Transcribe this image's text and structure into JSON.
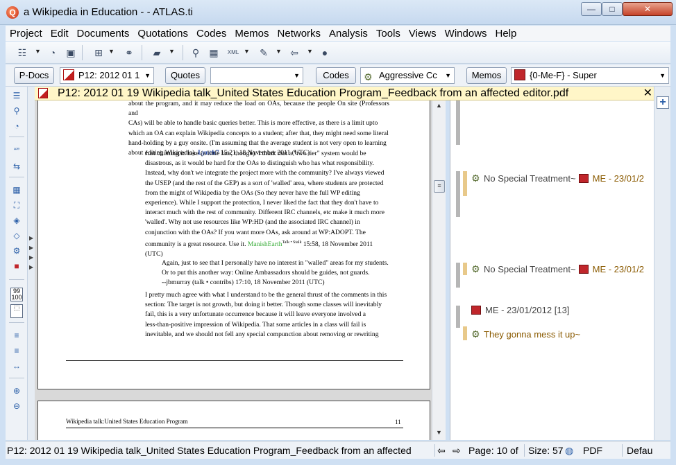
{
  "window": {
    "title": "a Wikipedia in Education - - ATLAS.ti",
    "app_icon_letter": "Q",
    "minimize": "—",
    "maximize": "□",
    "close": "✕"
  },
  "menu": [
    "Project",
    "Edit",
    "Documents",
    "Quotations",
    "Codes",
    "Memos",
    "Networks",
    "Analysis",
    "Tools",
    "Views",
    "Windows",
    "Help"
  ],
  "managers": {
    "pdocs_label": "P-Docs",
    "pdoc_selected": "P12: 2012 01 1",
    "quotes_label": "Quotes",
    "quotes_selected": "",
    "codes_label": "Codes",
    "code_selected": "Aggressive Cc",
    "memos_label": "Memos",
    "memo_selected": "{0-Me-F} - Super"
  },
  "document": {
    "title": "P12: 2012 01 19 Wikipedia talk_United States Education Program_Feedback from an affected editor.pdf",
    "close": "✕",
    "paragraphs": [
      {
        "lines": [
          "about the program, and it may reduce the load on OAs, because the people On site (Professors and",
          "CAs) will be able to handle basic queries better. This is more effective, as there is a limit upto",
          "which an OA can explain Wikipedia concepts to a student; after that, they might need some literal",
          "hand-holding by a guy onsite. (I'm assuming that the average student is not very open to learning"
        ],
        "tail": "about editing Wikipedia).",
        "sig": "Lynch7",
        "sig_after": " 15:21, 18 November 2011 (UTC)"
      },
      {
        "lines": [
          "Just chiming in here (a little late, though). I think that a \"two tier\" system would be",
          "disastrous, as it would be hard for the OAs to distinguish who has what responsibility.",
          "Instead, why don't we integrate the project more with the community? I've always viewed",
          "the USEP (and the rest of the GEP) as a sort of 'walled' area, where students are protected",
          "from the might of Wikipedia by the OAs (So they never have the full WP editing",
          "experience). While I support the protection, I never liked the fact that they don't have to",
          "interact much with the rest of community. Different IRC channels, etc make it much more",
          "'walled'. Why not use resources like WP:HD (and the associated IRC channel) in",
          "conjunction with the OAs? If you want more OAs, ask around at WP:ADOPT. The"
        ],
        "tail": "community is a great resource. Use it.",
        "sig": "ManishEarth",
        "sig_sup": "Talk • Stalk",
        "sig_after": " 15:58, 18 November 2011",
        "last": "(UTC)"
      },
      {
        "lines": [
          "Again, just to see that I personally have no interest in \"walled\" areas for my students.",
          "Or to put this another way: Online Ambassadors should be guides, not guards."
        ],
        "tail": "--jbmurray (talk • contribs) 17:10, 18 November 2011 (UTC)"
      },
      {
        "lines": [
          "I pretty much agree with what I understand to be the general thrust of the comments in this",
          "section: The target is not growth, but doing it better. Though some classes will inevitably",
          "fail, this is a very unfortunate occurrence because it will leave everyone involved a",
          "less-than-positive impression of Wikipedia. That some articles in a class will fail is",
          "inevitable, and we should not fell any special compunction about removing or rewriting"
        ]
      }
    ],
    "footer_left": "Wikipedia talk:United States Education Program",
    "footer_right": "11"
  },
  "margin": [
    {
      "code": "No Special Treatment~",
      "memo": "ME - 23/01/2"
    },
    {
      "code": "No Special Treatment~",
      "memo": "ME - 23/01/2"
    },
    {
      "memo_full": "ME - 23/01/2012 [13]"
    },
    {
      "code": "They gonna mess it up~"
    }
  ],
  "status": {
    "doc": "P12: 2012 01 19 Wikipedia talk_United States Education Program_Feedback from an affected",
    "page": "Page: 10 of",
    "size": "Size: 57%",
    "type": "PDF",
    "mode": "Defau"
  },
  "colors": {
    "memo_red": "#c0262b",
    "code_brown": "#8a5a00",
    "signature_blue": "#1a3c99",
    "signature_green": "#33aa33",
    "doc_strip": "#fff6c8"
  }
}
